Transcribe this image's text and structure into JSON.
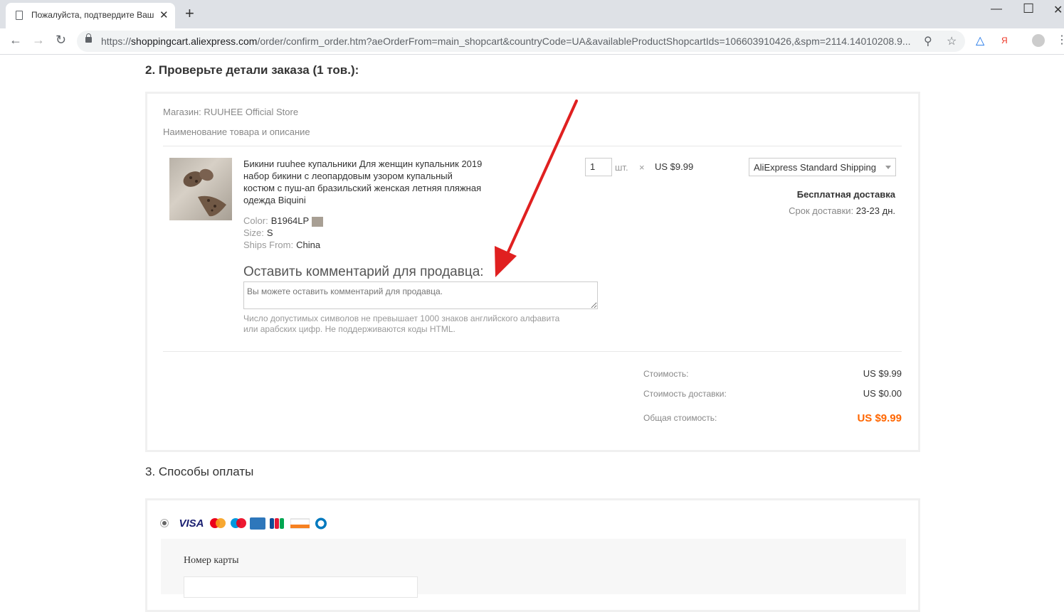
{
  "browser": {
    "tab_title": "Пожалуйста, подтвердите Ваш з",
    "url_scheme": "https://",
    "url_host": "shoppingcart.aliexpress.com",
    "url_path": "/order/confirm_order.htm?aeOrderFrom=main_shopcart&countryCode=UA&availableProductShopcartIds=106603910426,&spm=2114.14010208.9...",
    "ext_y": "Я"
  },
  "section2": {
    "heading": "2. Проверьте детали заказа (1 тов.):",
    "store_label": "Магазин:",
    "store_name": "RUUHEE Official Store",
    "col_header": "Наименование товара и описание",
    "product": {
      "name": "Бикини ruuhee купальники Для женщин купальник 2019 набор бикини с леопардовым узором купальный костюм с пуш-ап бразильский женская летняя пляжная одежда Biquini",
      "color_label": "Color:",
      "color_value": "B1964LP",
      "size_label": "Size:",
      "size_value": "S",
      "ships_label": "Ships From:",
      "ships_value": "China",
      "qty": "1",
      "unit": "шт.",
      "times": "×",
      "price": "US $9.99",
      "shipping_method": "AliExpress Standard Shipping",
      "free_delivery": "Бесплатная доставка",
      "delivery_label": "Срок доставки:",
      "delivery_value": "23-23 дн."
    },
    "comment": {
      "title": "Оставить комментарий для продавца:",
      "placeholder": "Вы можете оставить комментарий для продавца.",
      "hint": "Число допустимых символов не превышает 1000 знаков английского алфавита или арабских цифр. Не поддерживаются коды HTML."
    },
    "summary": {
      "cost_label": "Стоимость:",
      "cost_value": "US $9.99",
      "shipping_label": "Стоимость доставки:",
      "shipping_value": "US $0.00",
      "total_label": "Общая стоимость:",
      "total_value": "US $9.99"
    }
  },
  "section3": {
    "heading": "3. Способы оплаты",
    "card_label": "Номер карты",
    "visa": "VISA",
    "colors": {
      "visa": "#1a1f71",
      "mastercard_red": "#eb001b",
      "mastercard_yellow": "#f79e1b",
      "maestro_blue": "#0099df",
      "amex": "#2e77bb"
    }
  },
  "annotation": {
    "arrow_color": "#e02020"
  }
}
